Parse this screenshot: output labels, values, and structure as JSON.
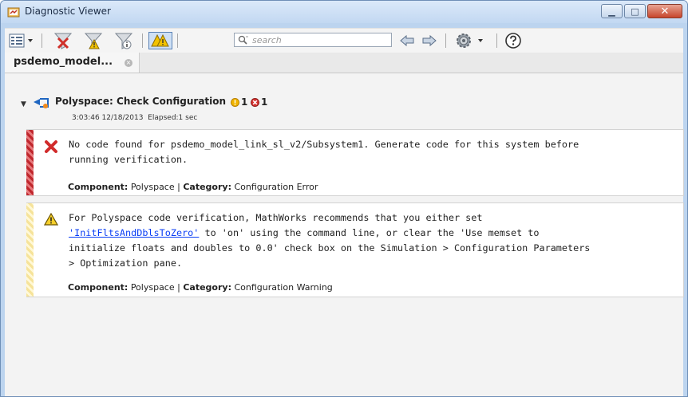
{
  "window": {
    "title": "Diagnostic Viewer",
    "minimize_glyph": "▁",
    "maximize_glyph": "□",
    "close_glyph": "✕"
  },
  "toolbar": {
    "search_placeholder": "search",
    "icons": [
      "view-menu-icon",
      "clear-filter-icon",
      "filter-errors-icon",
      "filter-info-icon",
      "show-warnings-icon",
      "search-icon",
      "back-arrow-icon",
      "forward-arrow-icon",
      "settings-gear-icon",
      "help-icon"
    ]
  },
  "tab": {
    "label": "psdemo_model...",
    "close_glyph": "×"
  },
  "diagnostic": {
    "expander_glyph": "▼",
    "title": "Polyspace: Check Configuration",
    "warning_count": "1",
    "error_count": "1",
    "timestamp": "3:03:46 12/18/2013",
    "elapsed": "Elapsed:1 sec"
  },
  "messages": [
    {
      "severity": "error",
      "text": "No code found for psdemo_model_link_sl_v2/Subsystem1. Generate code for this system before\nrunning verification.",
      "component_label": "Component:",
      "component": "Polyspace",
      "category_label": "Category:",
      "category": "Configuration Error"
    },
    {
      "severity": "warning",
      "text_before_link": "For Polyspace code verification, MathWorks recommends that you either set\n",
      "link": "'InitFltsAndDblsToZero'",
      "text_after_link": " to 'on' using the command line, or clear the 'Use memset to\ninitialize floats and doubles to 0.0' check box on the Simulation > Configuration Parameters\n> Optimization pane.",
      "component_label": "Component:",
      "component": "Polyspace",
      "category_label": "Category:",
      "category": "Configuration Warning"
    }
  ],
  "colors": {
    "error_red": "#c0272d",
    "warning_yellow": "#f6e39a",
    "link_blue": "#0a3ef5",
    "title_bar": "#c2d8f2"
  }
}
